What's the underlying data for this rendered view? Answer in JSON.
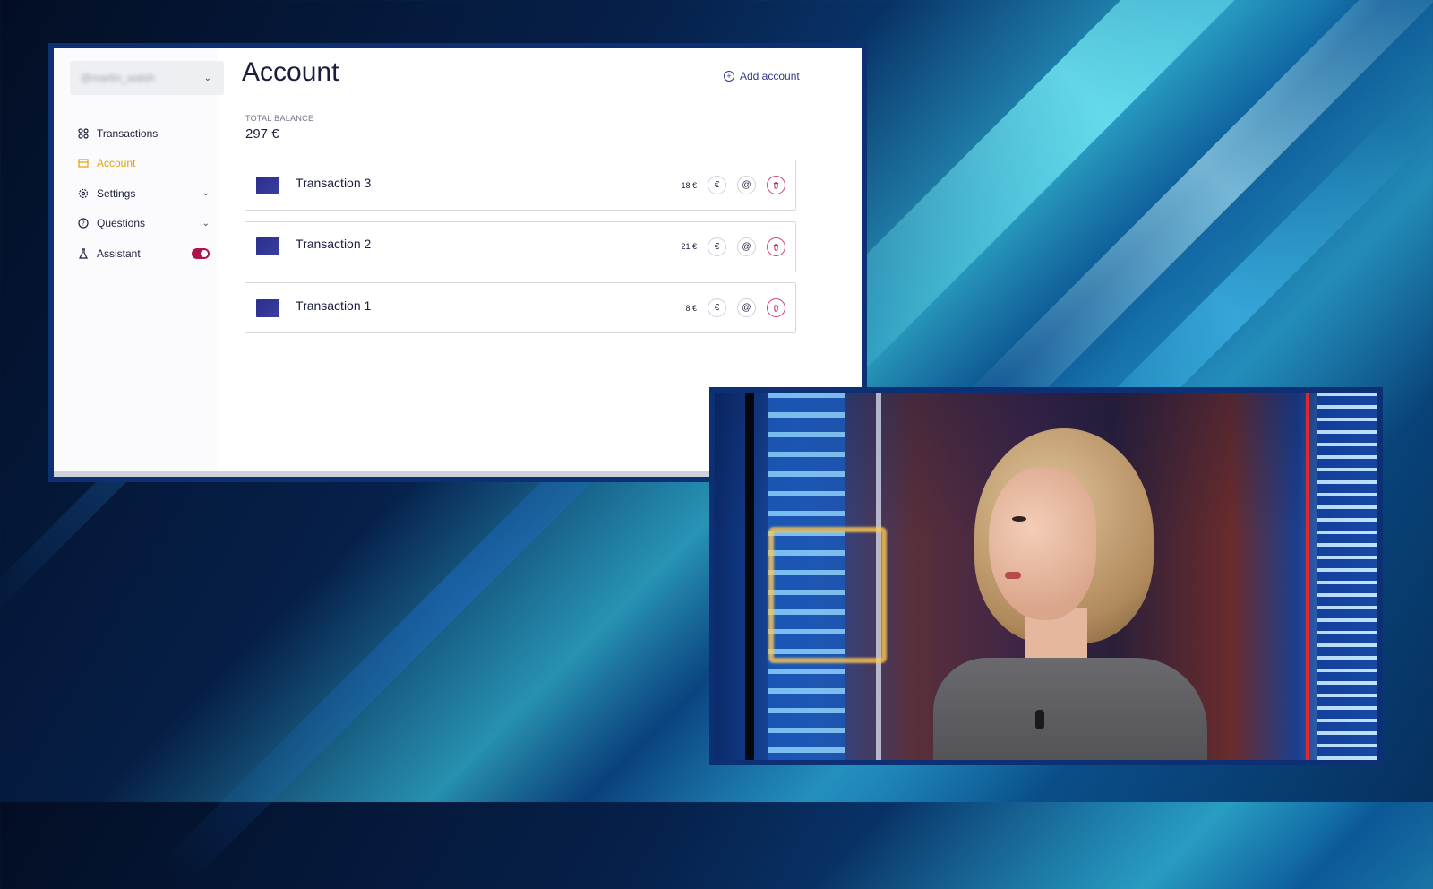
{
  "sidebar": {
    "account_selector": {
      "value": "@martin_walsh"
    },
    "items": [
      {
        "label": "Transactions",
        "icon": "grid-icon",
        "active": false,
        "expandable": false
      },
      {
        "label": "Account",
        "icon": "card-icon",
        "active": true,
        "expandable": false
      },
      {
        "label": "Settings",
        "icon": "gear-icon",
        "active": false,
        "expandable": true
      },
      {
        "label": "Questions",
        "icon": "question-icon",
        "active": false,
        "expandable": true
      },
      {
        "label": "Assistant",
        "icon": "flask-icon",
        "active": false,
        "toggle": true
      }
    ]
  },
  "header": {
    "title": "Account",
    "add_account_label": "Add account"
  },
  "balance": {
    "label": "TOTAL BALANCE",
    "value": "297 €"
  },
  "transactions": [
    {
      "name": "Transaction 3",
      "amount": "18 €"
    },
    {
      "name": "Transaction 2",
      "amount": "21 €"
    },
    {
      "name": "Transaction 1",
      "amount": "8 €"
    }
  ],
  "icons": {
    "euro_button": "€",
    "share_button": "@",
    "delete_button": "trash"
  },
  "colors": {
    "accent_active": "#e0a400",
    "danger": "#b0124a",
    "primary_text": "#1a1d3b",
    "frame_blue": "#0d2f73"
  }
}
